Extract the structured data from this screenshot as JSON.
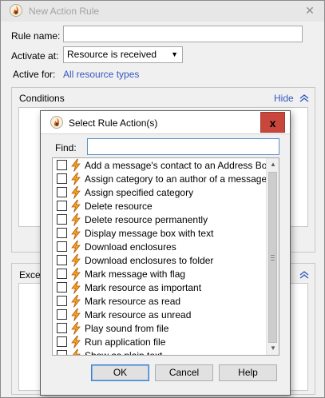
{
  "bg_window": {
    "title": "New Action Rule",
    "close_glyph": "✕",
    "rule_name_label": "Rule name:",
    "rule_name_value": "",
    "activate_at_label": "Activate at:",
    "activate_at_value": "Resource is received",
    "active_for_label": "Active for:",
    "active_for_link": "All resource types",
    "conditions_title": "Conditions",
    "conditions_hide": "Hide",
    "exceptions_title": "Excep"
  },
  "dialog": {
    "title": "Select Rule Action(s)",
    "close_glyph": "x",
    "find_label": "Find:",
    "find_value": "",
    "items": [
      {
        "label": "Add a message's contact to an Address Book",
        "checked": false
      },
      {
        "label": "Assign category to an author of a message",
        "checked": false
      },
      {
        "label": "Assign specified category",
        "checked": false
      },
      {
        "label": "Delete resource",
        "checked": false
      },
      {
        "label": "Delete resource permanently",
        "checked": false
      },
      {
        "label": "Display message box with text",
        "checked": false
      },
      {
        "label": "Download enclosures",
        "checked": false
      },
      {
        "label": "Download enclosures to folder",
        "checked": false
      },
      {
        "label": "Mark message with flag",
        "checked": false
      },
      {
        "label": "Mark resource as important",
        "checked": false
      },
      {
        "label": "Mark resource as read",
        "checked": false
      },
      {
        "label": "Mark resource as unread",
        "checked": false
      },
      {
        "label": "Play sound from file",
        "checked": false
      },
      {
        "label": "Run application file",
        "checked": false
      },
      {
        "label": "Show as plain text",
        "checked": false
      }
    ],
    "ok_label": "OK",
    "cancel_label": "Cancel",
    "help_label": "Help"
  },
  "colors": {
    "link": "#3357c0",
    "close_button": "#c8463b",
    "focus_border": "#5a8fc4"
  },
  "icons": {
    "app": "app-flame-icon",
    "action": "lightning-bolt-icon"
  }
}
